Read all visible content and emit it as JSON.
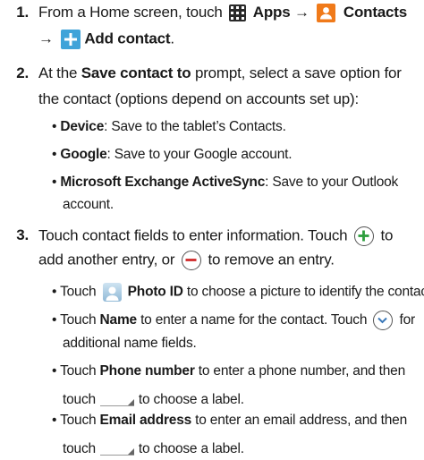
{
  "steps": [
    {
      "number": "1.",
      "line1": {
        "pre": "From a Home screen, touch",
        "apps": "Apps",
        "arrow1": "→",
        "contacts": "Contacts"
      },
      "line2": {
        "arrow": "→",
        "add_contact": "Add contact",
        "end": "."
      }
    },
    {
      "number": "2.",
      "line1": {
        "pre": "At the",
        "bold": "Save contact to",
        "post": "prompt, select a save option for"
      },
      "line2": "the contact (options depend on accounts set up):",
      "bullets": [
        {
          "bullet": "•",
          "bold": "Device",
          "text": ": Save to the tablet’s Contacts."
        },
        {
          "bullet": "•",
          "bold": "Google",
          "text": ": Save to your Google account."
        },
        {
          "bullet": "•",
          "bold": "Microsoft Exchange ActiveSync",
          "text": ": Save to your Outlook",
          "cont": "account."
        }
      ]
    },
    {
      "number": "3.",
      "line1": {
        "pre": "Touch contact fields to enter information. Touch",
        "post": "to"
      },
      "line2": {
        "pre": "add another entry, or",
        "post": "to remove an entry."
      },
      "bullets": [
        {
          "bullet": "•",
          "pre": "Touch",
          "bold": "Photo ID",
          "text": "to choose a picture to identify the contact."
        },
        {
          "bullet": "•",
          "pre": "Touch",
          "bold": "Name",
          "text": "to enter a name for the contact. Touch",
          "text_after": "for",
          "cont": "additional name fields."
        },
        {
          "bullet": "•",
          "pre": "Touch",
          "bold": "Phone number",
          "text": "to enter a phone number, and then",
          "cont_pre": "touch",
          "cont": "to choose a label."
        },
        {
          "bullet": "•",
          "pre": "Touch",
          "bold": "Email address",
          "text": "to enter an email address, and then",
          "cont_pre": "touch",
          "cont": "to choose a label."
        }
      ]
    }
  ],
  "icons": {
    "apps": "apps-grid-icon",
    "contacts": "contacts-icon",
    "add_contact": "add-contact-icon",
    "plus": "plus-circle-icon",
    "minus": "minus-circle-icon",
    "photo": "photo-id-icon",
    "expand": "chevron-down-circle-icon",
    "label": "label-dropdown-icon"
  },
  "colors": {
    "contacts_icon": "#f07a1a",
    "add_icon": "#3fa3d9",
    "plus_green": "#2e9e3e",
    "minus_red": "#d02a2a"
  }
}
